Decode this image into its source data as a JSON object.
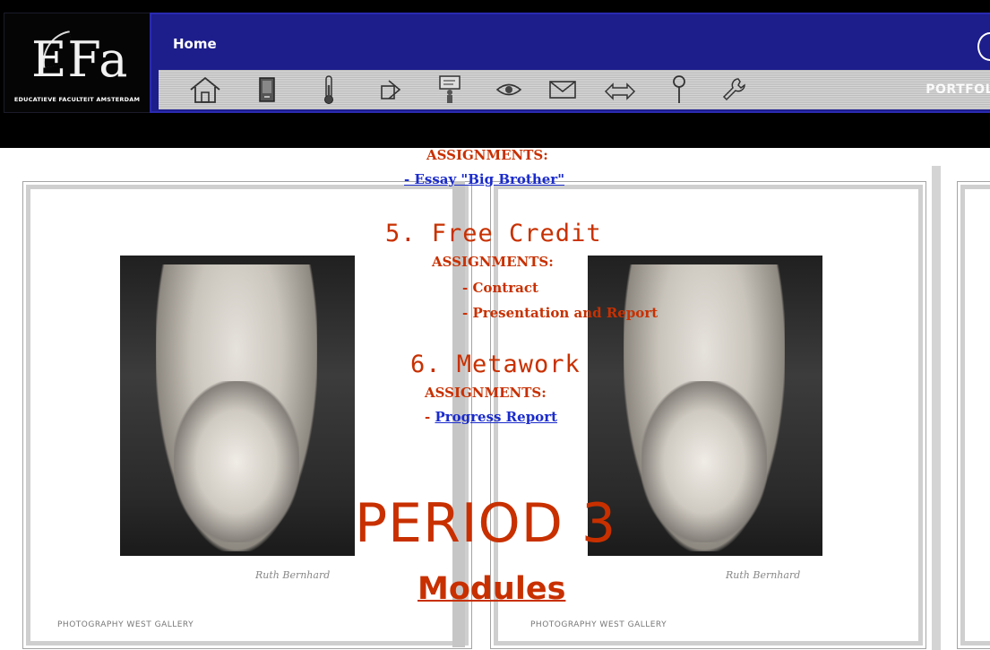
{
  "header": {
    "logo_mark": "EFa",
    "logo_text": "EDUCATIEVE FACULTEIT AMSTERDAM",
    "nav_title": "Home",
    "portfolio_label": "PORTFOL",
    "toolbar_icons": [
      "home-icon",
      "book-icon",
      "thermometer-icon",
      "shapes-icon",
      "presenter-icon",
      "eye-icon",
      "mail-icon",
      "arrows-icon",
      "pin-icon",
      "wrench-icon"
    ]
  },
  "content": {
    "assignments_label_1": "ASSIGNMENTS:",
    "essay_link": "- Essay \"Big Brother\"",
    "module_5_title": "5. Free Credit",
    "assignments_label_2": "ASSIGNMENTS:",
    "contract_item": "- Contract",
    "presentation_item": "- Presentation and Report",
    "module_6_title": "6. Metawork",
    "assignments_label_3": "ASSIGNMENTS:",
    "progress_prefix": "- ",
    "progress_link": "Progress Report",
    "period_title": "PERIOD 3",
    "modules_title": "Modules",
    "photo_signature": "Ruth Bernhard",
    "gallery_credit": "PHOTOGRAPHY WEST GALLERY"
  },
  "colors": {
    "header_blue": "#1d1d8c",
    "heading_red": "#c83000",
    "link_blue": "#1a2bcc"
  }
}
